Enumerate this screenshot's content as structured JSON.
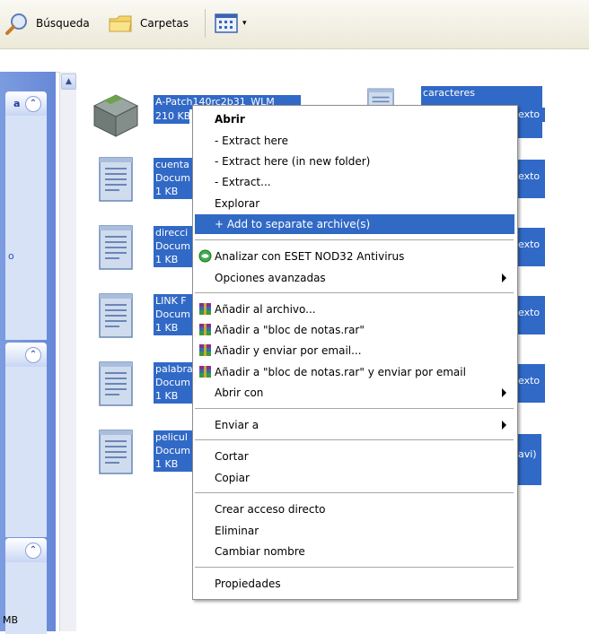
{
  "toolbar": {
    "search_label": "Búsqueda",
    "folders_label": "Carpetas"
  },
  "task_pane": {
    "panel3_text": "MB",
    "panel1_left_text": "",
    "panel1_mid_text": "o"
  },
  "files": [
    {
      "name": "A-Patch140rc2b31_WLM",
      "detail": "210 KB",
      "icon": "archive-box-icon"
    },
    {
      "name": "cuenta",
      "type": "Docum",
      "size": "1 KB",
      "icon": "text-document-icon"
    },
    {
      "name": "direcci",
      "type": "Docum",
      "size": "1 KB",
      "icon": "text-document-icon"
    },
    {
      "name": "LINK F",
      "type": "Docum",
      "size": "1 KB",
      "icon": "text-document-icon"
    },
    {
      "name": "palabra",
      "type": "Docum",
      "size": "1 KB",
      "icon": "text-document-icon"
    },
    {
      "name": "pelicul",
      "type": "Docum",
      "size": "1 KB",
      "icon": "text-document-icon"
    }
  ],
  "files_right": [
    {
      "name": "caracteres",
      "suffix": "exto"
    },
    {
      "suffix": "exto"
    },
    {
      "suffix": "exto"
    },
    {
      "suffix": "exto"
    },
    {
      "suffix": "exto"
    },
    {
      "suffix": "avi)"
    }
  ],
  "context_menu": {
    "open": "Abrir",
    "extract_here": "- Extract here",
    "extract_here_new": "- Extract here (in new folder)",
    "extract": "- Extract...",
    "explore": "Explorar",
    "add_separate": "+ Add to separate archive(s)",
    "eset_scan": "Analizar con ESET NOD32 Antivirus",
    "advanced_options": "Opciones avanzadas",
    "add_to_archive": "Añadir al archivo...",
    "add_to_rar": "Añadir a \"bloc de notas.rar\"",
    "add_and_email": "Añadir y enviar por email...",
    "add_rar_and_email": "Añadir a \"bloc de notas.rar\" y enviar por email",
    "open_with": "Abrir con",
    "send_to": "Enviar a",
    "cut": "Cortar",
    "copy": "Copiar",
    "create_shortcut": "Crear acceso directo",
    "delete": "Eliminar",
    "rename": "Cambiar nombre",
    "properties": "Propiedades"
  },
  "colors": {
    "selection": "#3169c6",
    "menu_highlight": "#316ac5",
    "task_pane": "#6f8fd9"
  }
}
